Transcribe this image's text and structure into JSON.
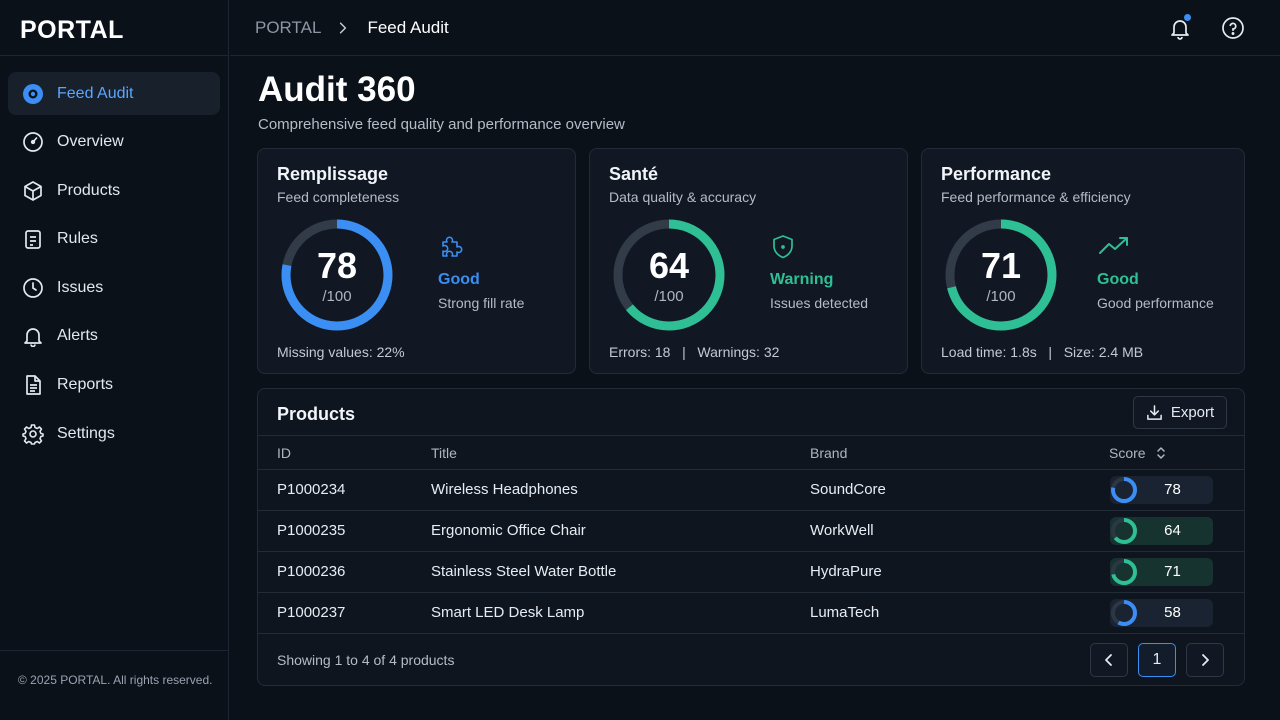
{
  "app": {
    "logo": "PORTAL",
    "footer": "© 2025 PORTAL. All rights reserved."
  },
  "sidebar": {
    "items": [
      {
        "label": "Feed Audit",
        "icon": "target-icon",
        "active": true
      },
      {
        "label": "Overview",
        "icon": "gauge-icon"
      },
      {
        "label": "Products",
        "icon": "box-icon"
      },
      {
        "label": "Rules",
        "icon": "clipboard-icon"
      },
      {
        "label": "Issues",
        "icon": "clock-icon"
      },
      {
        "label": "Alerts",
        "icon": "bell-icon"
      },
      {
        "label": "Reports",
        "icon": "document-icon"
      },
      {
        "label": "Settings",
        "icon": "gear-icon"
      }
    ]
  },
  "header": {
    "breadcrumb_root": "PORTAL",
    "breadcrumb_current": "Feed Audit",
    "notifications_unread": true
  },
  "page": {
    "title": "Audit 360",
    "subtitle": "Comprehensive feed quality and performance overview"
  },
  "cards": [
    {
      "title": "Remplissage",
      "subtitle": "Feed completeness",
      "score": 78,
      "max": "/100",
      "status": "Good",
      "status_desc": "Strong fill rate",
      "status_icon": "puzzle-icon",
      "color": "#3b8ef3",
      "footer": "Missing values: 22%"
    },
    {
      "title": "Santé",
      "subtitle": "Data quality & accuracy",
      "score": 64,
      "max": "/100",
      "status": "Warning",
      "status_desc": "Issues detected",
      "status_icon": "shield-icon",
      "color": "#2fbf94",
      "footer": "Errors: 18   |   Warnings: 32"
    },
    {
      "title": "Performance",
      "subtitle": "Feed performance & efficiency",
      "score": 71,
      "max": "/100",
      "status": "Good",
      "status_desc": "Good performance",
      "status_icon": "trending-up-icon",
      "color": "#2fbf94",
      "footer": "Load time: 1.8s   |   Size: 2.4 MB"
    }
  ],
  "products": {
    "title": "Products",
    "export_label": "Export",
    "columns": [
      "ID",
      "Title",
      "Brand",
      "Score"
    ],
    "rows": [
      {
        "id": "P1000234",
        "title": "Wireless Headphones",
        "brand": "SoundCore",
        "score": 78,
        "color": "#3b8ef3"
      },
      {
        "id": "P1000235",
        "title": "Ergonomic Office Chair",
        "brand": "WorkWell",
        "score": 64,
        "color": "#2fbf94"
      },
      {
        "id": "P1000236",
        "title": "Stainless Steel Water Bottle",
        "brand": "HydraPure",
        "score": 71,
        "color": "#2fbf94"
      },
      {
        "id": "P1000237",
        "title": "Smart LED Desk Lamp",
        "brand": "LumaTech",
        "score": 58,
        "color": "#3b8ef3"
      }
    ],
    "showing": "Showing 1 to 4 of 4 products",
    "page": "1"
  }
}
